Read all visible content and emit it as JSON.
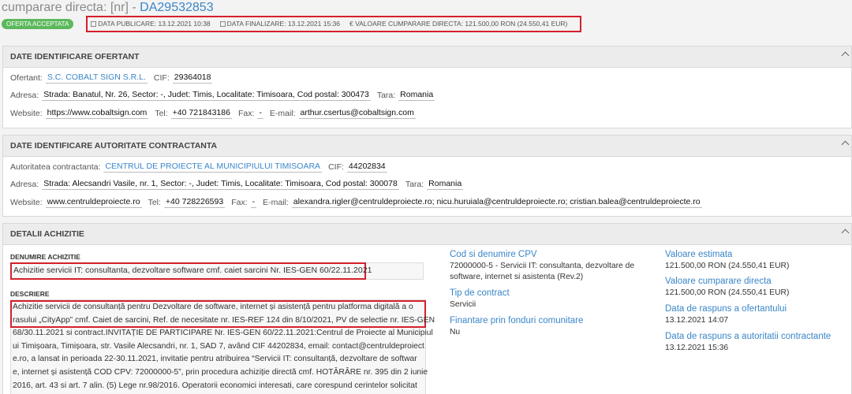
{
  "header": {
    "title_prefix": "cumparare directa: [nr] - ",
    "title_code": "DA29532853",
    "status_badge": "OFERTA ACCEPTATA",
    "data_publicare": "DATA PUBLICARE: 13.12.2021 10:38",
    "data_finalizare": "DATA FINALIZARE: 13.12.2021 15:36",
    "valoare": "€ VALOARE CUMPARARE DIRECTA: 121.500,00  RON (24.550,41  EUR)"
  },
  "ofertant": {
    "heading": "DATE IDENTIFICARE OFERTANT",
    "ofertant_label": "Ofertant:",
    "ofertant_value": "S.C. COBALT SIGN S.R.L.",
    "cif_label": "CIF:",
    "cif_value": "29364018",
    "adresa_label": "Adresa:",
    "adresa_value": "Strada: Banatul, Nr. 26, Sector: -, Judet: Timis, Localitate: Timisoara, Cod postal: 300473",
    "tara_label": "Tara:",
    "tara_value": "Romania",
    "website_label": "Website:",
    "website_value": "https://www.cobaltsign.com",
    "tel_label": "Tel:",
    "tel_value": "+40 721843186",
    "fax_label": "Fax:",
    "fax_value": "-",
    "email_label": "E-mail:",
    "email_value": "arthur.csertus@cobaltsign.com"
  },
  "autoritate": {
    "heading": "DATE IDENTIFICARE AUTORITATE CONTRACTANTA",
    "autoritate_label": "Autoritatea contractanta:",
    "autoritate_value": "CENTRUL DE PROIECTE AL MUNICIPIULUI TIMISOARA",
    "cif_label": "CIF:",
    "cif_value": "44202834",
    "adresa_label": "Adresa:",
    "adresa_value": "Strada: Alecsandri Vasile, nr. 1, Sector: -, Judet: Timis, Localitate: Timisoara, Cod postal: 300078",
    "tara_label": "Tara:",
    "tara_value": "Romania",
    "website_label": "Website:",
    "website_value": "www.centruldeproiecte.ro",
    "tel_label": "Tel:",
    "tel_value": "+40 728226593",
    "fax_label": "Fax:",
    "fax_value": "-",
    "email_label": "E-mail:",
    "email_value": "alexandra.rigler@centruldeproiecte.ro; nicu.huruiala@centruldeproiecte.ro; cristian.balea@centruldeproiecte.ro"
  },
  "detalii": {
    "heading": "DETALII ACHIZITIE",
    "denumire_label": "DENUMIRE ACHIZITIE",
    "denumire_value": "Achizitie servicii IT: consultanta, dezvoltare software cmf. caiet sarcini Nr. IES-GEN 60/22.11.2021",
    "descriere_label": "DESCRIERE",
    "descriere_lines": [
      "Achizitie servicii de consultanță pentru Dezvoltare de software, internet și asistență pentru platforma digitală a o",
      "rasului „CityApp” cmf. Caiet de sarcini, Ref. de necesitate nr. IES-REF 124 din 8/10/2021, PV de selectie nr. IES-GEN",
      "68/30.11.2021 si contract.INVITAȚIE DE PARTICIPARE Nr. IES-GEN 60/22.11.2021:Centrul de Proiecte al Municipiul",
      "ui Timișoara, Timișoara, str. Vasile Alecsandri, nr. 1, SAD 7, având CIF 44202834, email: contact@centruldeproiect",
      "e.ro, a lansat in perioada 22-30.11.2021, invitatie pentru atribuirea “Servicii IT: consultanță, dezvoltare de softwar",
      "e, internet și asistență COD CPV: 72000000-5”, prin procedura achiziție directă cmf. HOTĂRÂRE nr. 395 din 2 iunie",
      "2016, art. 43 si art. 7 alin. (5) Lege nr.98/2016. Operatorii economici interesati, care corespund cerintelor solicitat"
    ],
    "cpv_title": "Cod si denumire CPV",
    "cpv_value": "72000000-5 - Servicii IT: consultanta, dezvoltare de software, internet si asistenta (Rev.2)",
    "tip_title": "Tip de contract",
    "tip_value": "Servicii",
    "finantare_title": "Finantare prin fonduri comunitare",
    "finantare_value": "Nu",
    "estimata_title": "Valoare estimata",
    "estimata_value": "121.500,00  RON (24.550,41  EUR)",
    "cumparare_title": "Valoare cumparare directa",
    "cumparare_value": "121.500,00  RON (24.550,41  EUR)",
    "raspuns_ofertant_title": "Data de raspuns a ofertantului",
    "raspuns_ofertant_value": "13.12.2021 14:07",
    "raspuns_autoritate_title": "Data de raspuns a autoritatii contractante",
    "raspuns_autoritate_value": "13.12.2021 15:36"
  }
}
